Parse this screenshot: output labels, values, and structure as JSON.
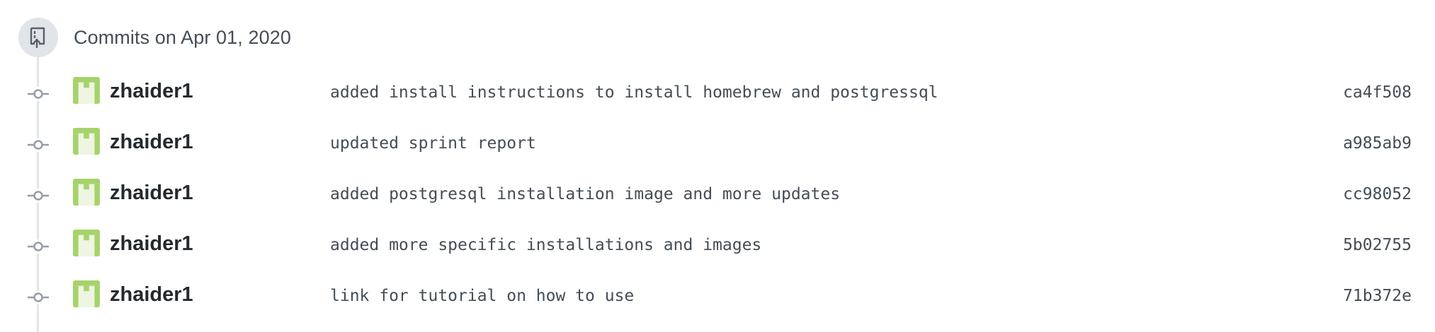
{
  "group": {
    "title": "Commits on Apr 01, 2020",
    "icon": "repo-push-icon"
  },
  "commits": [
    {
      "author": "zhaider1",
      "message": "added install instructions to install homebrew and postgressql",
      "sha": "ca4f508"
    },
    {
      "author": "zhaider1",
      "message": "updated sprint report",
      "sha": "a985ab9"
    },
    {
      "author": "zhaider1",
      "message": "added postgresql installation image and more updates",
      "sha": "cc98052"
    },
    {
      "author": "zhaider1",
      "message": "added more specific installations and images",
      "sha": "5b02755"
    },
    {
      "author": "zhaider1",
      "message": "link for tutorial on how to use",
      "sha": "71b372e"
    }
  ],
  "colors": {
    "avatar_green": "#a6d36b",
    "avatar_bg": "#eef5e2",
    "timeline": "#e1e4e8",
    "node": "#959da5"
  }
}
